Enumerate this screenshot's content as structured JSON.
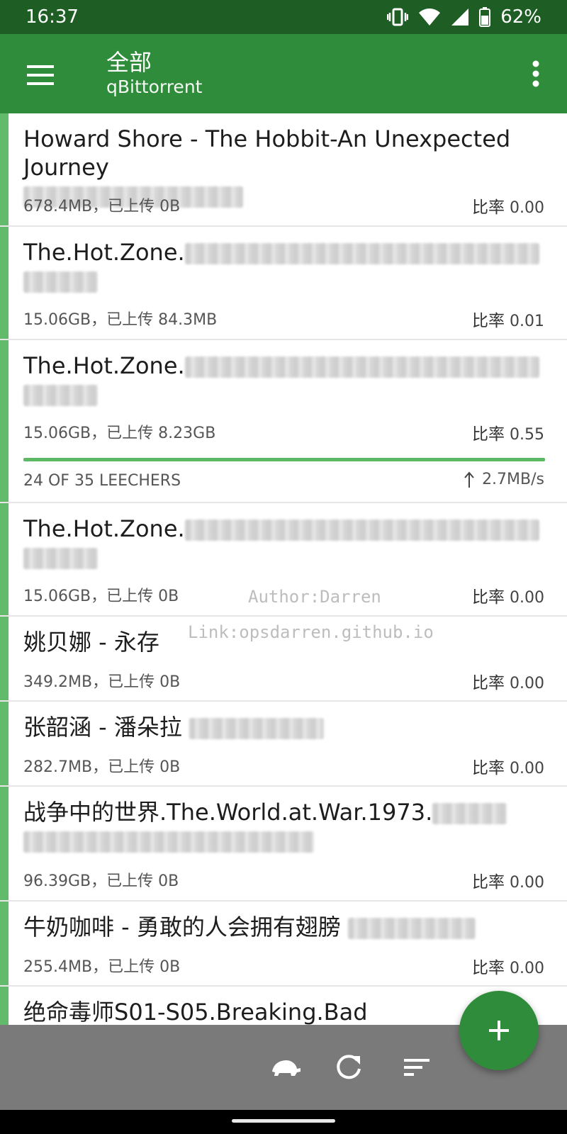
{
  "status_bar": {
    "time": "16:37",
    "battery": "62%"
  },
  "app_bar": {
    "title": "全部",
    "subtitle": "qBittorrent"
  },
  "torrents": [
    {
      "name": "Howard Shore - The Hobbit-An Unexpected Journey",
      "size": "678.4MB",
      "uploaded_label": "已上传",
      "uploaded": "0B",
      "ratio_label": "比率",
      "ratio": "0.00"
    },
    {
      "name": "The.Hot.Zone.",
      "size": "15.06GB",
      "uploaded_label": "已上传",
      "uploaded": "84.3MB",
      "ratio_label": "比率",
      "ratio": "0.01"
    },
    {
      "name": "The.Hot.Zone.",
      "size": "15.06GB",
      "uploaded_label": "已上传",
      "uploaded": "8.23GB",
      "ratio_label": "比率",
      "ratio": "0.55",
      "progress": 1.0,
      "leechers": "24 OF 35 LEECHERS",
      "upload_speed": "2.7MB/s"
    },
    {
      "name": "The.Hot.Zone.",
      "size": "15.06GB",
      "uploaded_label": "已上传",
      "uploaded": "0B",
      "ratio_label": "比率",
      "ratio": "0.00"
    },
    {
      "name": "姚贝娜 - 永存",
      "size": "349.2MB",
      "uploaded_label": "已上传",
      "uploaded": "0B",
      "ratio_label": "比率",
      "ratio": "0.00"
    },
    {
      "name": "张韶涵 - 潘朵拉",
      "size": "282.7MB",
      "uploaded_label": "已上传",
      "uploaded": "0B",
      "ratio_label": "比率",
      "ratio": "0.00"
    },
    {
      "name": "战争中的世界.The.World.at.War.1973.",
      "size": "96.39GB",
      "uploaded_label": "已上传",
      "uploaded": "0B",
      "ratio_label": "比率",
      "ratio": "0.00"
    },
    {
      "name": "牛奶咖啡 - 勇敢的人会拥有翅膀",
      "size": "255.4MB",
      "uploaded_label": "已上传",
      "uploaded": "0B",
      "ratio_label": "比率",
      "ratio": "0.00"
    },
    {
      "name": "绝命毒师S01-S05.Breaking.Bad"
    }
  ],
  "watermark": {
    "author": "Author:Darren",
    "link": "Link:opsdarren.github.io"
  },
  "bottom_bar": {
    "icons": [
      "turtle-icon",
      "refresh-icon",
      "sort-icon"
    ]
  },
  "fab": {
    "icon": "plus-icon"
  },
  "colors": {
    "status_bar": "#1e5e25",
    "app_bar": "#2f8c3a",
    "accent": "#62bb6a",
    "bottom_bar": "#7a7a7a"
  }
}
